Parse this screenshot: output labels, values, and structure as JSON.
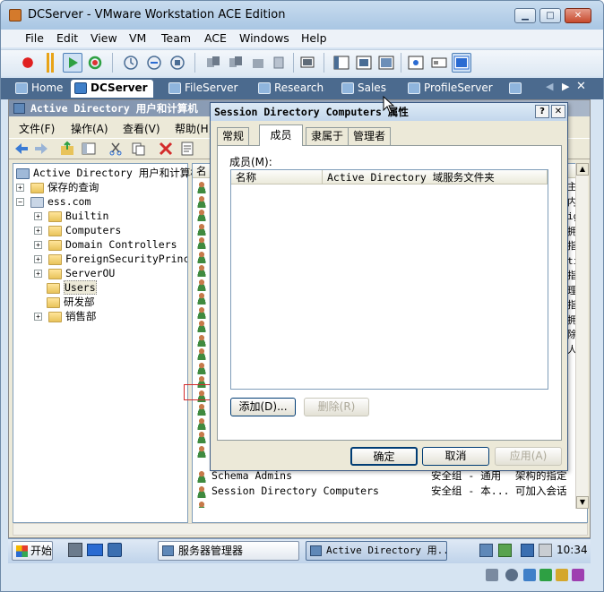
{
  "vmware": {
    "title": "DCServer - VMware Workstation ACE Edition",
    "caption": {
      "minimize": "▁",
      "maximize": "□",
      "close": "✕"
    },
    "menu": [
      "File",
      "Edit",
      "View",
      "VM",
      "Team",
      "ACE",
      "Windows",
      "Help"
    ],
    "tabs": [
      {
        "label": "Home",
        "active": false
      },
      {
        "label": "DCServer",
        "active": true
      },
      {
        "label": "FileServer",
        "active": false
      },
      {
        "label": "Research",
        "active": false
      },
      {
        "label": "Sales",
        "active": false
      },
      {
        "label": "ProfileServer",
        "active": false
      }
    ],
    "tab_nav": {
      "prev": "◀",
      "next": "▶",
      "close": "✕"
    },
    "colors": {
      "titlebar": "#a9c6e3",
      "tabstrip": "#4b6a8e",
      "accent": "#3f7fc8"
    }
  },
  "mmc": {
    "title": "Active Directory 用户和计算机",
    "menu": [
      "文件(F)",
      "操作(A)",
      "查看(V)",
      "帮助(H)"
    ],
    "tree": {
      "root": "Active Directory 用户和计算机",
      "saved_queries": "保存的查询",
      "domain": "ess.com",
      "children": [
        "Builtin",
        "Computers",
        "Domain Controllers",
        "ForeignSecurityPrincip",
        "ServerOU",
        "Users",
        "研发部",
        "销售部"
      ],
      "expander_plus": "+",
      "expander_minus": "−"
    },
    "list": {
      "column_name_stub": "名",
      "visible_rows": [
        {
          "name": "Schema Admins",
          "type": "安全组 - 通用",
          "desc": "架构的指定"
        },
        {
          "name": "Session Directory Computers",
          "type": "安全组 - 本...",
          "desc": "可加入会话"
        }
      ],
      "right_edge_chars": [
        "主",
        "内",
        "ig",
        "拥",
        "指",
        "ti",
        "指",
        "理",
        "指",
        "拥",
        "除",
        "人"
      ]
    }
  },
  "dialog": {
    "title": "Session Directory Computers 属性",
    "help_btn": "?",
    "close_btn": "✕",
    "tabs": [
      "常规",
      "成员",
      "隶属于",
      "管理者"
    ],
    "active_tab": "成员",
    "members_label": "成员(M):",
    "columns": [
      "名称",
      "Active Directory 域服务文件夹"
    ],
    "add_button": "添加(D)...",
    "remove_button": "删除(R)",
    "ok": "确定",
    "cancel": "取消",
    "apply": "应用(A)"
  },
  "taskbar": {
    "start": "开始",
    "items": [
      {
        "label": "服务器管理器",
        "active": false
      },
      {
        "label": "Active Directory 用...",
        "active": true
      }
    ],
    "clock": "10:34"
  }
}
